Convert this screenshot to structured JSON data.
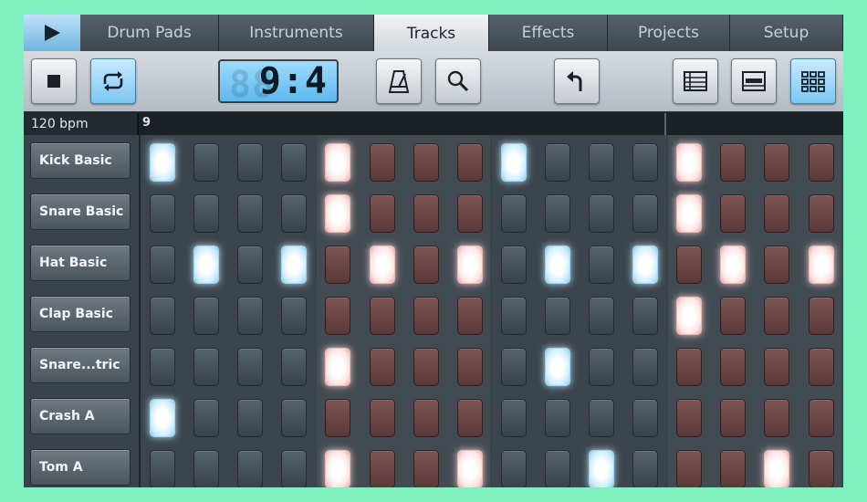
{
  "tabs": [
    {
      "label": "Drum Pads",
      "active": false
    },
    {
      "label": "Instruments",
      "active": false
    },
    {
      "label": "Tracks",
      "active": true
    },
    {
      "label": "Effects",
      "active": false
    },
    {
      "label": "Projects",
      "active": false
    },
    {
      "label": "Setup",
      "active": false
    }
  ],
  "toolbar": {
    "lcd_value": "9:4",
    "lcd_ghost": "88"
  },
  "timeline": {
    "bpm": "120 bpm",
    "bar": "9"
  },
  "tracks": [
    {
      "name": "Kick Basic",
      "steps": [
        1,
        0,
        0,
        0,
        1,
        0,
        0,
        0,
        1,
        0,
        0,
        0,
        1,
        0,
        0,
        0
      ]
    },
    {
      "name": "Snare Basic",
      "steps": [
        0,
        0,
        0,
        0,
        1,
        0,
        0,
        0,
        0,
        0,
        0,
        0,
        1,
        0,
        0,
        0
      ]
    },
    {
      "name": "Hat Basic",
      "steps": [
        0,
        1,
        0,
        1,
        0,
        1,
        0,
        1,
        0,
        1,
        0,
        1,
        0,
        1,
        0,
        1
      ]
    },
    {
      "name": "Clap Basic",
      "steps": [
        0,
        0,
        0,
        0,
        0,
        0,
        0,
        0,
        0,
        0,
        0,
        0,
        1,
        0,
        0,
        0
      ]
    },
    {
      "name": "Snare...tric",
      "steps": [
        0,
        0,
        0,
        0,
        1,
        0,
        0,
        0,
        0,
        1,
        0,
        0,
        0,
        0,
        0,
        0
      ]
    },
    {
      "name": "Crash A",
      "steps": [
        1,
        0,
        0,
        0,
        0,
        0,
        0,
        0,
        0,
        0,
        0,
        0,
        0,
        0,
        0,
        0
      ]
    },
    {
      "name": "Tom A",
      "steps": [
        0,
        0,
        0,
        0,
        1,
        0,
        0,
        1,
        0,
        0,
        1,
        0,
        0,
        0,
        1,
        0
      ]
    }
  ],
  "colors": {
    "accent_blue": "#7cc6f2",
    "frame_green": "#7ff0c0"
  }
}
